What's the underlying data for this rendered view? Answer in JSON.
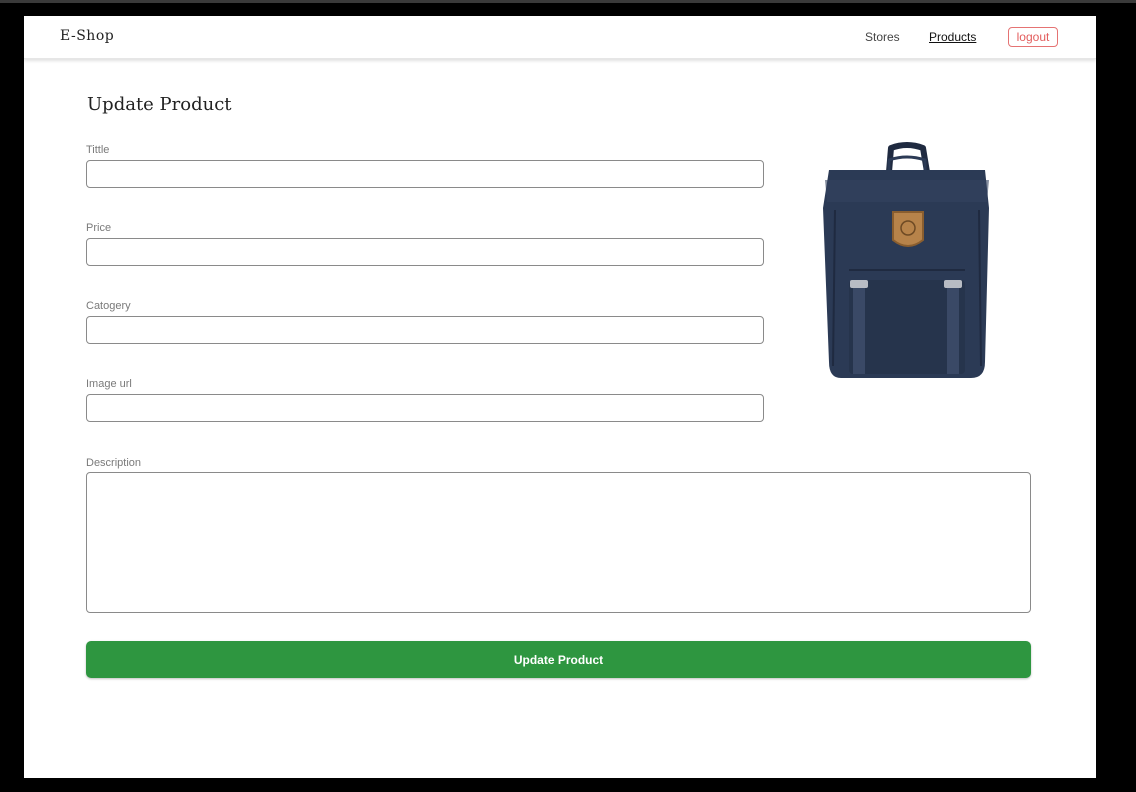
{
  "app": {
    "brand": "E-Shop"
  },
  "nav": {
    "links": [
      {
        "label": "Stores"
      },
      {
        "label": "Products"
      }
    ],
    "logout_label": "logout"
  },
  "page": {
    "title": "Update Product"
  },
  "form": {
    "fields": [
      {
        "label": "Tittle",
        "value": ""
      },
      {
        "label": "Price",
        "value": ""
      },
      {
        "label": "Catogery",
        "value": ""
      },
      {
        "label": "Image url",
        "value": ""
      }
    ],
    "description": {
      "label": "Description",
      "value": ""
    },
    "submit_label": "Update Product"
  },
  "image": {
    "subject": "backpack-image"
  },
  "colors": {
    "accent_green": "#2e9640",
    "logout_red": "#e35d5d",
    "backpack_navy": "#2b3a55"
  }
}
